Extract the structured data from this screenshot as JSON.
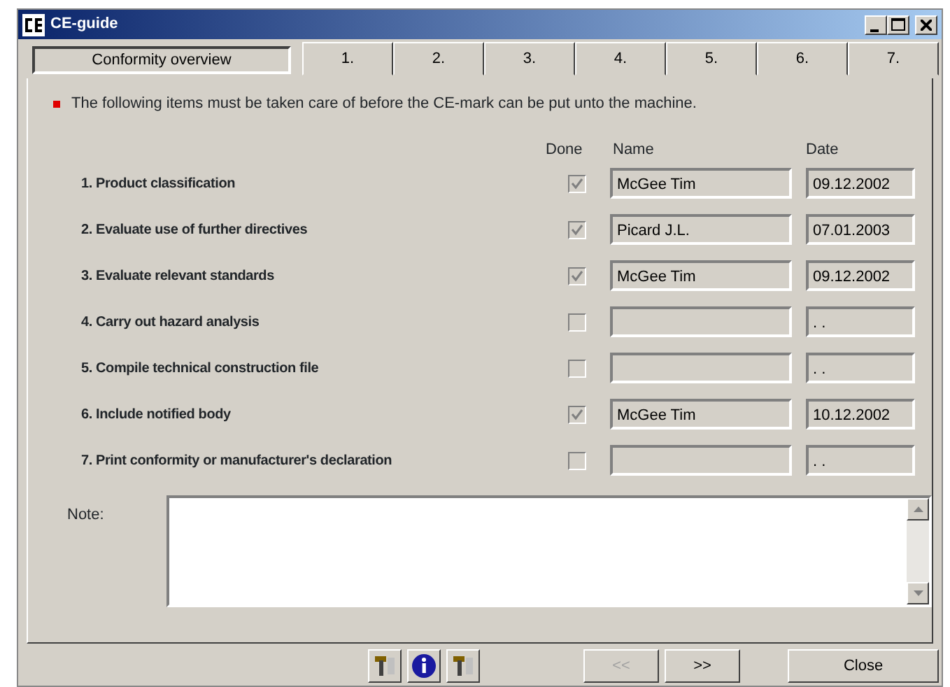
{
  "window": {
    "title": "CE-guide"
  },
  "tabs": [
    {
      "label": "Conformity overview",
      "selected": true
    },
    {
      "label": "1.",
      "selected": false
    },
    {
      "label": "2.",
      "selected": false
    },
    {
      "label": "3.",
      "selected": false
    },
    {
      "label": "4.",
      "selected": false
    },
    {
      "label": "5.",
      "selected": false
    },
    {
      "label": "6.",
      "selected": false
    },
    {
      "label": "7.",
      "selected": false
    }
  ],
  "notice": "The following items must be taken care of before the CE-mark can be put unto the machine.",
  "columns": {
    "done": "Done",
    "name": "Name",
    "date": "Date"
  },
  "items": [
    {
      "label": "1. Product classification",
      "done": true,
      "name": "McGee Tim",
      "date": "09.12.2002"
    },
    {
      "label": "2. Evaluate use of further directives",
      "done": true,
      "name": "Picard J.L.",
      "date": "07.01.2003"
    },
    {
      "label": "3. Evaluate relevant standards",
      "done": true,
      "name": "McGee Tim",
      "date": "09.12.2002"
    },
    {
      "label": "4. Carry out hazard analysis",
      "done": false,
      "date": ". ."
    },
    {
      "label": "5. Compile technical construction file",
      "done": false,
      "date": ". ."
    },
    {
      "label": "6. Include notified body",
      "done": true,
      "name": "McGee Tim",
      "date": "10.12.2002"
    },
    {
      "label": "7. Print conformity or manufacturer's declaration",
      "done": false,
      "date": ". ."
    }
  ],
  "note": {
    "label": "Note:"
  },
  "nav_buttons": [
    {
      "label": "<<",
      "disabled": true
    },
    {
      "label": ">>",
      "disabled": false
    }
  ],
  "close_button": "Close"
}
